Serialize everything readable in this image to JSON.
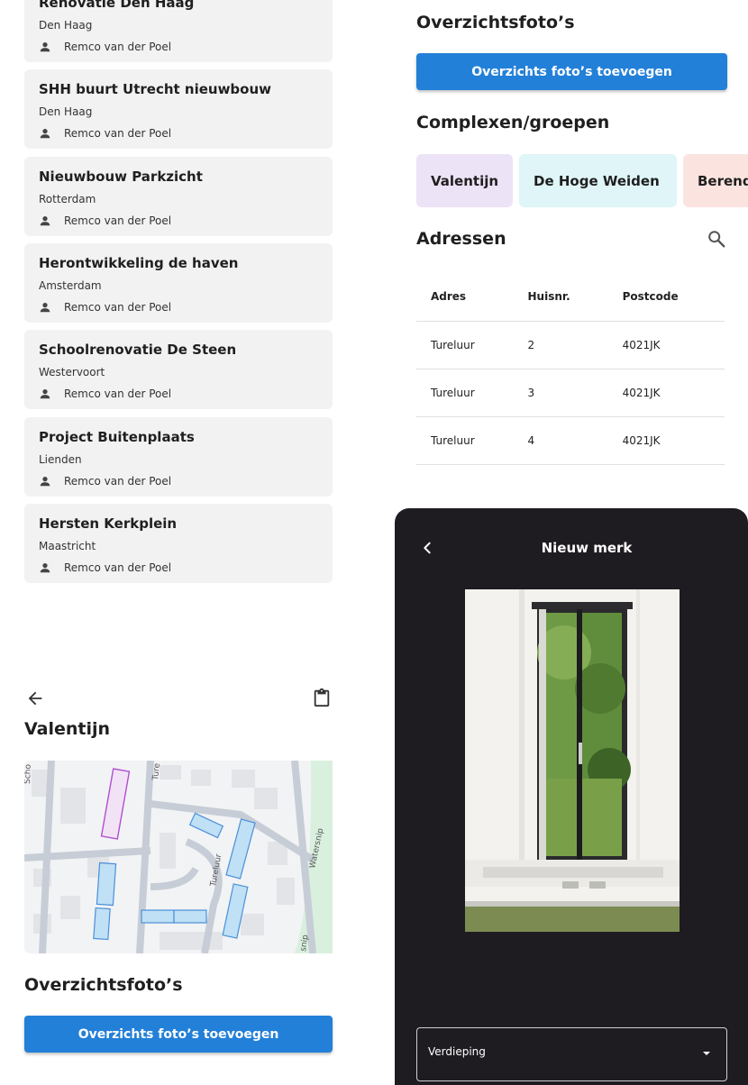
{
  "projects": [
    {
      "title": "Renovatie Den Haag",
      "city": "Den Haag",
      "owner": "Remco van der Poel"
    },
    {
      "title": "SHH buurt Utrecht nieuwbouw",
      "city": "Den Haag",
      "owner": "Remco van der Poel"
    },
    {
      "title": "Nieuwbouw Parkzicht",
      "city": "Rotterdam",
      "owner": "Remco van der Poel"
    },
    {
      "title": "Herontwikkeling de haven",
      "city": "Amsterdam",
      "owner": "Remco van der Poel"
    },
    {
      "title": "Schoolrenovatie De Steen",
      "city": "Westervoort",
      "owner": "Remco van der Poel"
    },
    {
      "title": "Project Buitenplaats",
      "city": "Lienden",
      "owner": "Remco van der Poel"
    },
    {
      "title": "Hersten Kerkplein",
      "city": "Maastricht",
      "owner": "Remco van der Poel"
    }
  ],
  "overview": {
    "title": "Overzichtsfoto’s",
    "add_button": "Overzichts foto’s toevoegen"
  },
  "complexes": {
    "title": "Complexen/groepen",
    "chips": [
      {
        "label": "Valentijn",
        "color": "#ece3f6"
      },
      {
        "label": "De Hoge Weiden",
        "color": "#dff5f7"
      },
      {
        "label": "Berend",
        "color": "#fbe4e0"
      }
    ]
  },
  "addresses": {
    "title": "Adressen",
    "columns": [
      "Adres",
      "Huisnr.",
      "Postcode"
    ],
    "rows": [
      [
        "Tureluur",
        "2",
        "4021JK"
      ],
      [
        "Tureluur",
        "3",
        "4021JK"
      ],
      [
        "Tureluur",
        "4",
        "4021JK"
      ]
    ]
  },
  "detail": {
    "title": "Valentijn",
    "map_labels": {
      "street_top": "Scho",
      "street_tur": "Ture",
      "tureluur": "Tureluur",
      "watersnip": "Watersnip",
      "snip": "snip"
    },
    "overview_title": "Overzichtsfoto’s",
    "add_button": "Overzichts foto’s toevoegen"
  },
  "new_brand": {
    "title": "Nieuw merk",
    "select_label": "Verdieping"
  },
  "colors": {
    "accent": "#2380d8",
    "dark": "#1f1c21"
  }
}
